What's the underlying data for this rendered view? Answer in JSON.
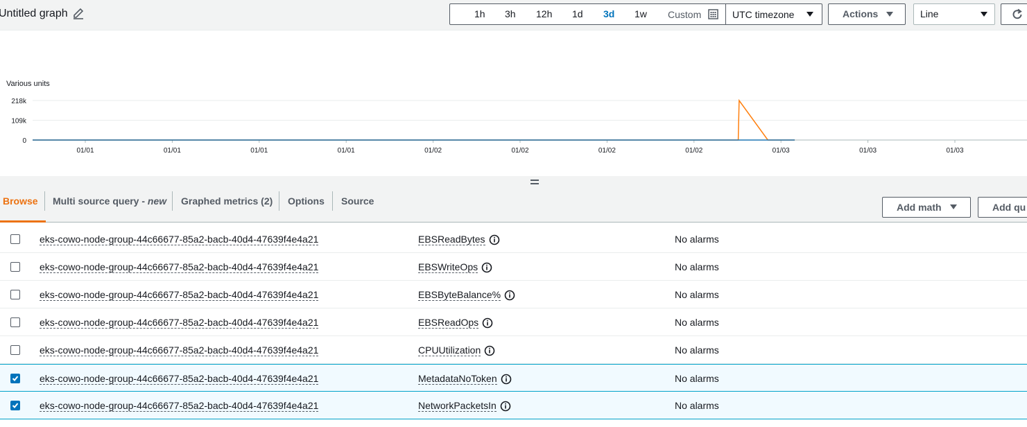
{
  "graph": {
    "title": "Untitled graph"
  },
  "time_range": {
    "options": [
      "1h",
      "3h",
      "12h",
      "1d",
      "3d",
      "1w"
    ],
    "active": "3d",
    "custom_label": "Custom"
  },
  "timezone": {
    "value": "UTC timezone"
  },
  "actions_label": "Actions",
  "chart_type_select": {
    "value": "Line"
  },
  "chart_data": {
    "type": "line",
    "ylabel": "Various units",
    "y_ticks": [
      "218k",
      "109k",
      "0"
    ],
    "ylim": [
      0,
      218000
    ],
    "x_ticks": [
      "01/01",
      "01/01",
      "01/01",
      "01/01",
      "01/02",
      "01/02",
      "01/02",
      "01/02",
      "01/03",
      "01/03",
      "01/03"
    ],
    "grid": true,
    "series": [
      {
        "color": "#ff7f0e",
        "x": [
          0.0,
          0.787,
          0.788,
          0.82,
          0.85
        ],
        "values": [
          0,
          0,
          218000,
          0,
          0
        ]
      },
      {
        "color": "#1f77b4",
        "x": [
          0.0,
          0.787,
          0.85
        ],
        "values": [
          0,
          0,
          0
        ]
      }
    ]
  },
  "tabs": [
    {
      "label": "Browse",
      "active": true
    },
    {
      "label": "Multi source query - ",
      "badge": "new"
    },
    {
      "label": "Graphed metrics (2)"
    },
    {
      "label": "Options"
    },
    {
      "label": "Source"
    }
  ],
  "add_math_label": "Add math",
  "add_query_label": "Add qu",
  "rows": [
    {
      "checked": false,
      "instance": "eks-cowo-node-group-44c66677-85a2-bacb-40d4-47639f4e4a21",
      "metric": "EBSReadBytes",
      "alarms": "No alarms"
    },
    {
      "checked": false,
      "instance": "eks-cowo-node-group-44c66677-85a2-bacb-40d4-47639f4e4a21",
      "metric": "EBSWriteOps",
      "alarms": "No alarms"
    },
    {
      "checked": false,
      "instance": "eks-cowo-node-group-44c66677-85a2-bacb-40d4-47639f4e4a21",
      "metric": "EBSByteBalance%",
      "alarms": "No alarms"
    },
    {
      "checked": false,
      "instance": "eks-cowo-node-group-44c66677-85a2-bacb-40d4-47639f4e4a21",
      "metric": "EBSReadOps",
      "alarms": "No alarms"
    },
    {
      "checked": false,
      "instance": "eks-cowo-node-group-44c66677-85a2-bacb-40d4-47639f4e4a21",
      "metric": "CPUUtilization",
      "alarms": "No alarms"
    },
    {
      "checked": true,
      "instance": "eks-cowo-node-group-44c66677-85a2-bacb-40d4-47639f4e4a21",
      "metric": "MetadataNoToken",
      "alarms": "No alarms"
    },
    {
      "checked": true,
      "instance": "eks-cowo-node-group-44c66677-85a2-bacb-40d4-47639f4e4a21",
      "metric": "NetworkPacketsIn",
      "alarms": "No alarms"
    }
  ]
}
